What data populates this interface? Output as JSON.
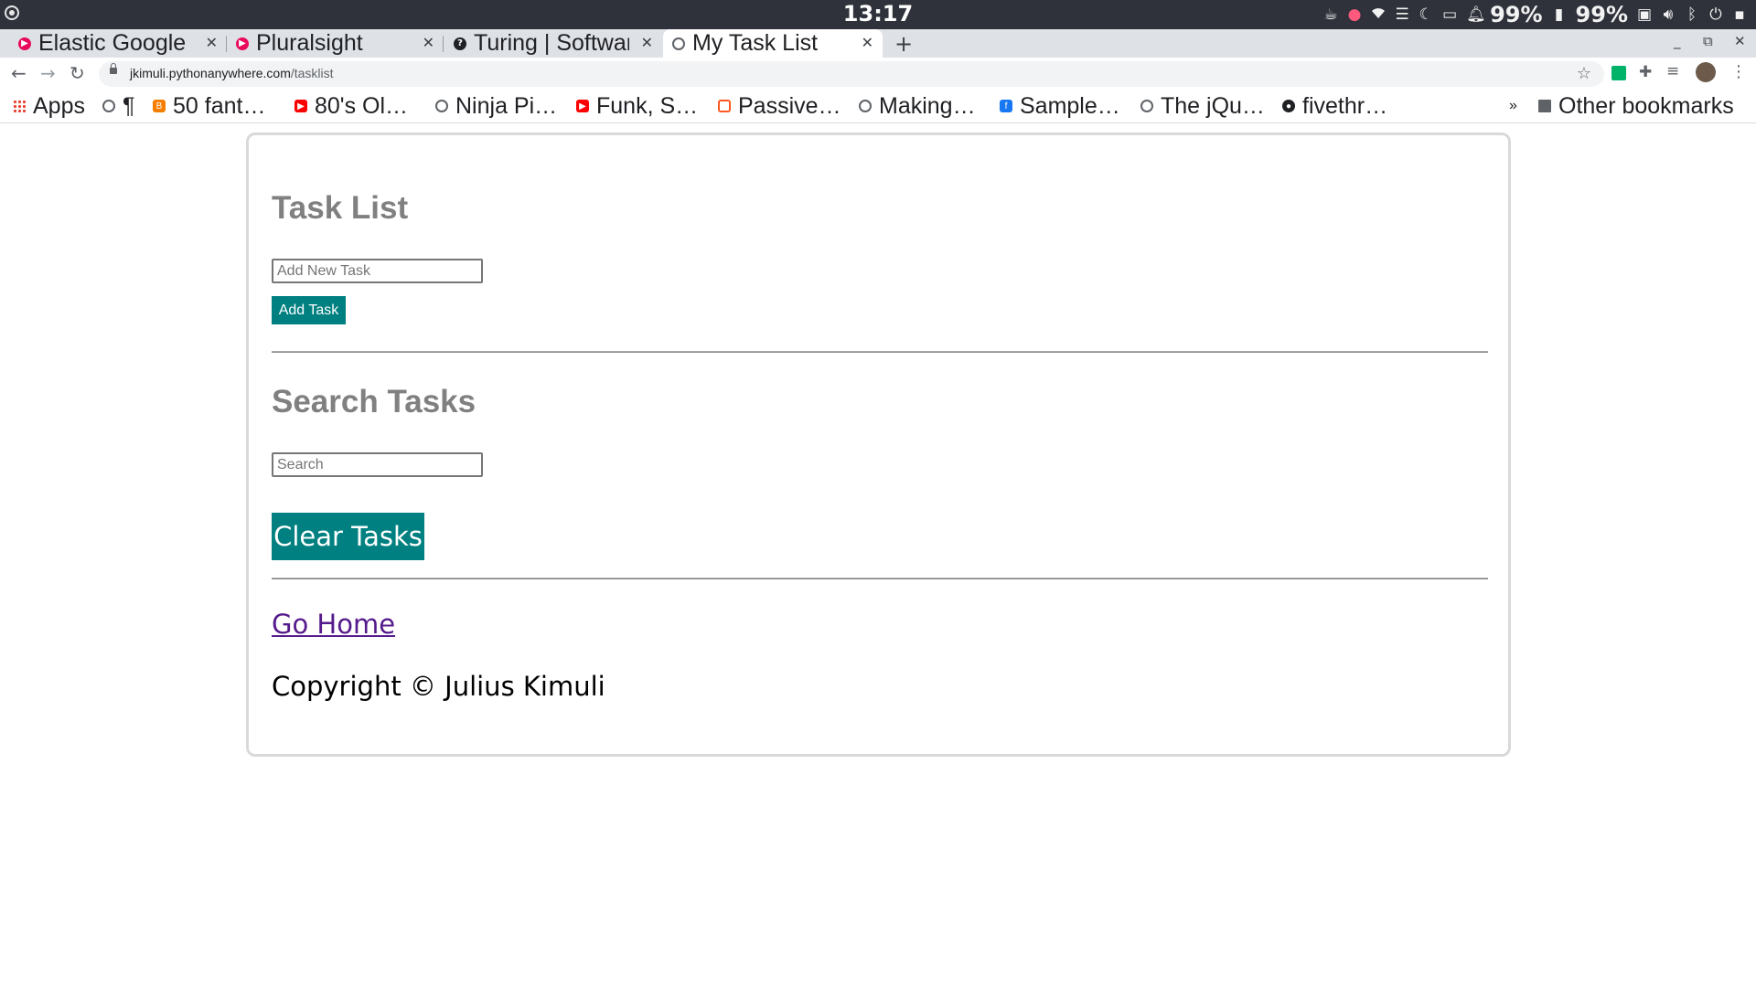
{
  "os": {
    "clock": "13:17",
    "battery_1": "99%",
    "battery_2": "99%"
  },
  "browser": {
    "tabs": [
      {
        "label": "Elastic Google",
        "favicon": "pluralsight-logo-icon",
        "color": "#e80a5b",
        "active": false
      },
      {
        "label": "Pluralsight",
        "favicon": "pluralsight-logo-icon",
        "color": "#e80a5b",
        "active": false
      },
      {
        "label": "Turing | Software",
        "favicon": "turing-logo-icon",
        "color": "#202124",
        "active": false
      },
      {
        "label": "My Task List",
        "favicon": "globe-icon",
        "color": "#5f6368",
        "active": true
      }
    ],
    "new_tab": "+",
    "url": {
      "host": "jkimuli.pythonanywhere.com",
      "path": "/tasklist"
    },
    "bookmarks": [
      {
        "label": "Apps",
        "icon": "apps-grid-icon"
      },
      {
        "label": "¶",
        "icon": "globe-icon"
      },
      {
        "label": "50 fant…",
        "icon": "blogger-icon",
        "color": "#f57d00"
      },
      {
        "label": "80's Ol…",
        "icon": "youtube-icon",
        "color": "#ff0000"
      },
      {
        "label": "Ninja Pi…",
        "icon": "globe-icon"
      },
      {
        "label": "Funk, S…",
        "icon": "youtube-icon",
        "color": "#ff0000"
      },
      {
        "label": "Passive…",
        "icon": "chip-icon",
        "color": "#ff5722"
      },
      {
        "label": "Making…",
        "icon": "globe-icon"
      },
      {
        "label": "Sample…",
        "icon": "facebook-icon",
        "color": "#1877f2"
      },
      {
        "label": "The jQu…",
        "icon": "globe-icon"
      },
      {
        "label": "fivethr…",
        "icon": "fivethirtyeight-icon"
      }
    ],
    "overflow": "»",
    "other_bookmarks": "Other bookmarks"
  },
  "page": {
    "task_list_heading": "Task List",
    "add_task_placeholder": "Add New Task",
    "add_task_button": "Add Task",
    "search_heading": "Search Tasks",
    "search_placeholder": "Search",
    "clear_tasks_button": "Clear Tasks",
    "go_home_link": "Go Home",
    "copyright": "Copyright © Julius Kimuli",
    "accent_color": "#008080",
    "heading_color": "#808080"
  }
}
